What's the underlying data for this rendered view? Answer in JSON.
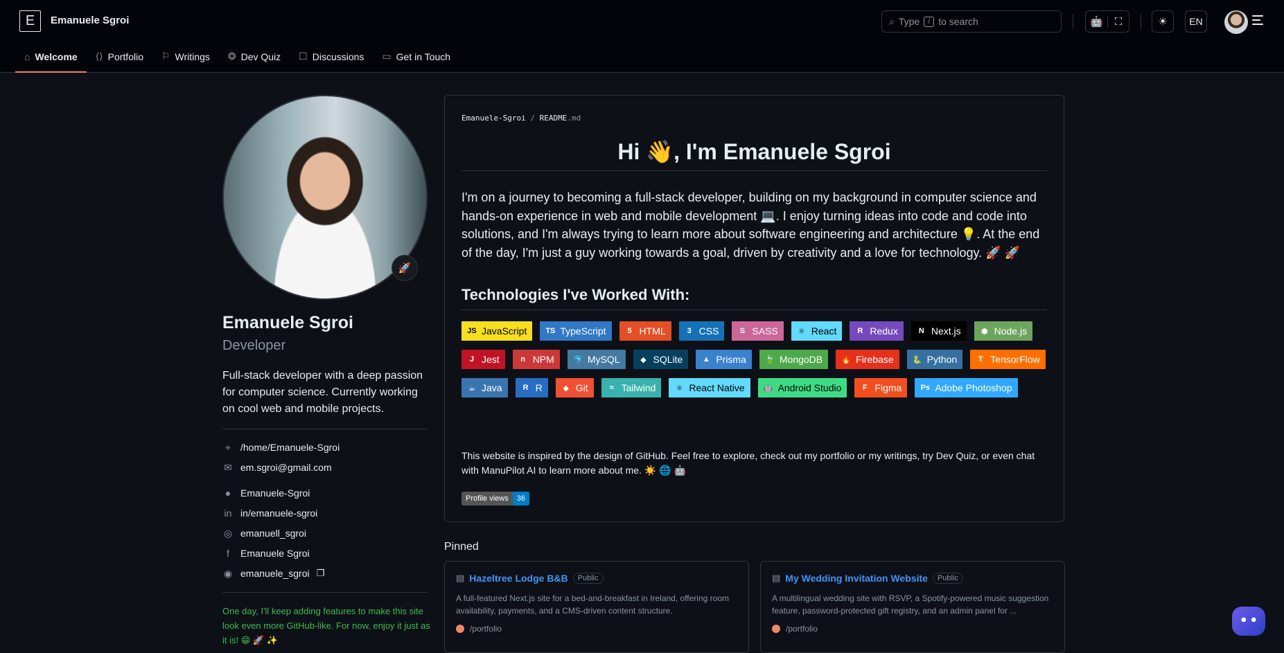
{
  "header": {
    "logo_letter": "E",
    "brand": "Emanuele Sgroi",
    "search_placeholder": "Type",
    "search_key": "/",
    "search_suffix": "to search",
    "lang": "EN"
  },
  "nav": {
    "items": [
      {
        "label": "Welcome",
        "icon": "home-icon"
      },
      {
        "label": "Portfolio",
        "icon": "code-icon"
      },
      {
        "label": "Writings",
        "icon": "bookmark-icon"
      },
      {
        "label": "Dev Quiz",
        "icon": "brain-icon"
      },
      {
        "label": "Discussions",
        "icon": "comments-icon"
      },
      {
        "label": "Get in Touch",
        "icon": "message-icon"
      }
    ]
  },
  "profile": {
    "name": "Emanuele Sgroi",
    "role": "Developer",
    "bio": "Full-stack developer with a deep passion for computer science. Currently working on cool web and mobile projects.",
    "location": "/home/Emanuele-Sgroi",
    "email": "em.sgroi@gmail.com",
    "github": "Emanuele-Sgroi",
    "linkedin": "in/emanuele-sgroi",
    "instagram": "emanuell_sgroi",
    "facebook": "Emanuele Sgroi",
    "discord": "emanuele_sgroi",
    "footer_note": "One day, I'll keep adding features to make this site look even more GitHub-like. For now, enjoy it just as it is! 😁 🚀 ✨"
  },
  "readme": {
    "crumb_user": "Emanuele-Sgroi",
    "crumb_sep": "/",
    "crumb_file": "README",
    "crumb_ext": ".md",
    "heading": "Hi 👋, I'm Emanuele Sgroi",
    "intro": "I'm on a journey to becoming a full-stack developer, building on my background in computer science and hands-on experience in web and mobile development 💻. I enjoy turning ideas into code and code into solutions, and I'm always trying to learn more about software engineering and architecture 💡. At the end of the day, I'm just a guy working towards a goal, driven by creativity and a love for technology. 🚀 🚀",
    "tech_heading": "Technologies I've Worked With:",
    "badges": [
      {
        "label": "JavaScript",
        "bg": "#F7DF1E",
        "fg": "#000000",
        "logo": "JS"
      },
      {
        "label": "TypeScript",
        "bg": "#3178C6",
        "fg": "#ffffff",
        "logo": "TS"
      },
      {
        "label": "HTML",
        "bg": "#E34F26",
        "fg": "#ffffff",
        "logo": "5"
      },
      {
        "label": "CSS",
        "bg": "#1572B6",
        "fg": "#ffffff",
        "logo": "3"
      },
      {
        "label": "SASS",
        "bg": "#CC6699",
        "fg": "#ffffff",
        "logo": "S"
      },
      {
        "label": "React",
        "bg": "#61DAFB",
        "fg": "#000000",
        "logo": "⚛"
      },
      {
        "label": "Redux",
        "bg": "#764ABC",
        "fg": "#ffffff",
        "logo": "R"
      },
      {
        "label": "Next.js",
        "bg": "#000000",
        "fg": "#ffffff",
        "logo": "N"
      },
      {
        "label": "Node.js",
        "bg": "#6DA55F",
        "fg": "#ffffff",
        "logo": "⬢"
      },
      {
        "label": "Jest",
        "bg": "#C21325",
        "fg": "#ffffff",
        "logo": "J"
      },
      {
        "label": "NPM",
        "bg": "#CB3837",
        "fg": "#ffffff",
        "logo": "n"
      },
      {
        "label": "MySQL",
        "bg": "#4479A1",
        "fg": "#ffffff",
        "logo": "🐬"
      },
      {
        "label": "SQLite",
        "bg": "#07405E",
        "fg": "#ffffff",
        "logo": "◆"
      },
      {
        "label": "Prisma",
        "bg": "#3982CE",
        "fg": "#ffffff",
        "logo": "▲"
      },
      {
        "label": "MongoDB",
        "bg": "#4EA94B",
        "fg": "#ffffff",
        "logo": "🍃"
      },
      {
        "label": "Firebase",
        "bg": "#E7301C",
        "fg": "#ffffff",
        "logo": "🔥"
      },
      {
        "label": "Python",
        "bg": "#3670A0",
        "fg": "#ffffff",
        "logo": "🐍"
      },
      {
        "label": "TensorFlow",
        "bg": "#FF6F00",
        "fg": "#ffffff",
        "logo": "T"
      },
      {
        "label": "Java",
        "bg": "#3A75B0",
        "fg": "#ffffff",
        "logo": "☕"
      },
      {
        "label": "R",
        "bg": "#276DC3",
        "fg": "#ffffff",
        "logo": "R"
      },
      {
        "label": "Git",
        "bg": "#F05033",
        "fg": "#ffffff",
        "logo": "◆"
      },
      {
        "label": "Tailwind",
        "bg": "#38B2AC",
        "fg": "#ffffff",
        "logo": "≈"
      },
      {
        "label": "React Native",
        "bg": "#61DAFB",
        "fg": "#000000",
        "logo": "⚛"
      },
      {
        "label": "Android Studio",
        "bg": "#3DDC84",
        "fg": "#000000",
        "logo": "🤖"
      },
      {
        "label": "Figma",
        "bg": "#F24E1E",
        "fg": "#ffffff",
        "logo": "F"
      },
      {
        "label": "Adobe Photoshop",
        "bg": "#31A8FF",
        "fg": "#ffffff",
        "logo": "Ps"
      }
    ],
    "inspired": "This website is inspired by the design of GitHub. Feel free to explore, check out my portfolio or my writings, try Dev Quiz, or even chat with ManuPilot AI to learn more about me. ☀️ 🌐 🤖",
    "views_label": "Profile views",
    "views_count": "36"
  },
  "pinned": {
    "heading": "Pinned",
    "cards": [
      {
        "title": "Hazeltree Lodge B&B",
        "visibility": "Public",
        "description": "A full-featured Next.js site for a bed-and-breakfast in Ireland, offering room availability, payments, and a CMS-driven content structure.",
        "path": "/portfolio"
      },
      {
        "title": "My Wedding Invitation Website",
        "visibility": "Public",
        "description": "A multilingual wedding site with RSVP, a Spotify-powered music suggestion feature, password-protected gift registry, and an admin panel for ...",
        "path": "/portfolio"
      }
    ]
  }
}
